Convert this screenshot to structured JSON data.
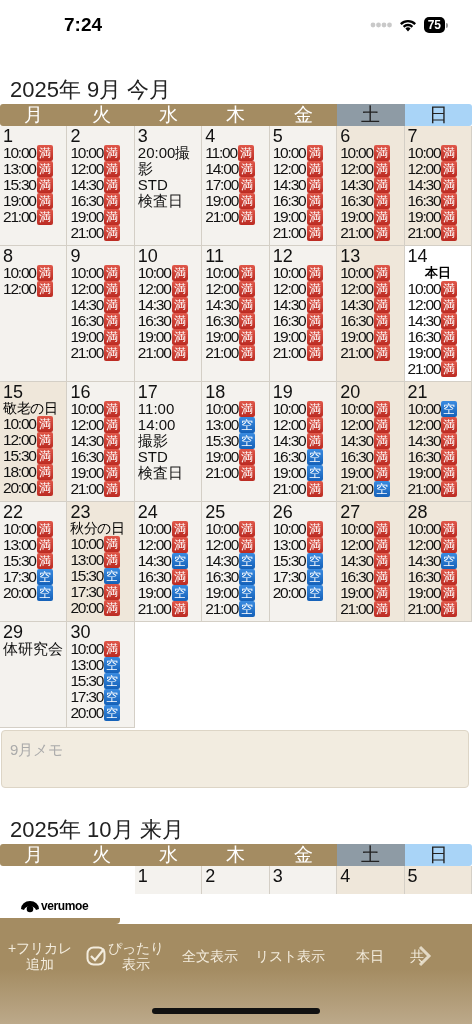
{
  "status_bar": {
    "time": "7:24",
    "battery": "75"
  },
  "months": [
    {
      "title": "2025年 9月 今月",
      "weekdays": [
        {
          "label": "月",
          "kind": "weekday"
        },
        {
          "label": "火",
          "kind": "weekday"
        },
        {
          "label": "水",
          "kind": "weekday"
        },
        {
          "label": "木",
          "kind": "weekday"
        },
        {
          "label": "金",
          "kind": "weekday"
        },
        {
          "label": "土",
          "kind": "saturday"
        },
        {
          "label": "日",
          "kind": "sunday"
        }
      ],
      "weeks": [
        [
          {
            "day": "1",
            "kind": "plain",
            "slots": [
              {
                "time": "10:00",
                "mark": "満",
                "kind": "full"
              },
              {
                "time": "13:00",
                "mark": "満",
                "kind": "full"
              },
              {
                "time": "15:30",
                "mark": "満",
                "kind": "full"
              },
              {
                "time": "19:00",
                "mark": "満",
                "kind": "full"
              },
              {
                "time": "21:00",
                "mark": "満",
                "kind": "full"
              }
            ]
          },
          {
            "day": "2",
            "kind": "plain",
            "slots": [
              {
                "time": "10:00",
                "mark": "満",
                "kind": "full"
              },
              {
                "time": "12:00",
                "mark": "満",
                "kind": "full"
              },
              {
                "time": "14:30",
                "mark": "満",
                "kind": "full"
              },
              {
                "time": "16:30",
                "mark": "満",
                "kind": "full"
              },
              {
                "time": "19:00",
                "mark": "満",
                "kind": "full"
              },
              {
                "time": "21:00",
                "mark": "満",
                "kind": "full"
              }
            ]
          },
          {
            "day": "3",
            "kind": "plain",
            "notes": [
              "20:00撮影",
              "STD",
              "検査日"
            ]
          },
          {
            "day": "4",
            "kind": "plain",
            "slots": [
              {
                "time": "11:00",
                "mark": "満",
                "kind": "full"
              },
              {
                "time": "14:00",
                "mark": "満",
                "kind": "full"
              },
              {
                "time": "17:00",
                "mark": "満",
                "kind": "full"
              },
              {
                "time": "19:00",
                "mark": "満",
                "kind": "full"
              },
              {
                "time": "21:00",
                "mark": "満",
                "kind": "full"
              }
            ]
          },
          {
            "day": "5",
            "kind": "plain",
            "slots": [
              {
                "time": "10:00",
                "mark": "満",
                "kind": "full"
              },
              {
                "time": "12:00",
                "mark": "満",
                "kind": "full"
              },
              {
                "time": "14:30",
                "mark": "満",
                "kind": "full"
              },
              {
                "time": "16:30",
                "mark": "満",
                "kind": "full"
              },
              {
                "time": "19:00",
                "mark": "満",
                "kind": "full"
              },
              {
                "time": "21:00",
                "mark": "満",
                "kind": "full"
              }
            ]
          },
          {
            "day": "6",
            "kind": "shaded",
            "slots": [
              {
                "time": "10:00",
                "mark": "満",
                "kind": "full"
              },
              {
                "time": "12:00",
                "mark": "満",
                "kind": "full"
              },
              {
                "time": "14:30",
                "mark": "満",
                "kind": "full"
              },
              {
                "time": "16:30",
                "mark": "満",
                "kind": "full"
              },
              {
                "time": "19:00",
                "mark": "満",
                "kind": "full"
              },
              {
                "time": "21:00",
                "mark": "満",
                "kind": "full"
              }
            ]
          },
          {
            "day": "7",
            "kind": "shaded",
            "slots": [
              {
                "time": "10:00",
                "mark": "満",
                "kind": "full"
              },
              {
                "time": "12:00",
                "mark": "満",
                "kind": "full"
              },
              {
                "time": "14:30",
                "mark": "満",
                "kind": "full"
              },
              {
                "time": "16:30",
                "mark": "満",
                "kind": "full"
              },
              {
                "time": "19:00",
                "mark": "満",
                "kind": "full"
              },
              {
                "time": "21:00",
                "mark": "満",
                "kind": "full"
              }
            ]
          }
        ],
        [
          {
            "day": "8",
            "kind": "plain",
            "slots": [
              {
                "time": "10:00",
                "mark": "満",
                "kind": "full"
              },
              {
                "time": "12:00",
                "mark": "満",
                "kind": "full"
              }
            ]
          },
          {
            "day": "9",
            "kind": "plain",
            "slots": [
              {
                "time": "10:00",
                "mark": "満",
                "kind": "full"
              },
              {
                "time": "12:00",
                "mark": "満",
                "kind": "full"
              },
              {
                "time": "14:30",
                "mark": "満",
                "kind": "full"
              },
              {
                "time": "16:30",
                "mark": "満",
                "kind": "full"
              },
              {
                "time": "19:00",
                "mark": "満",
                "kind": "full"
              },
              {
                "time": "21:00",
                "mark": "満",
                "kind": "full"
              }
            ]
          },
          {
            "day": "10",
            "kind": "plain",
            "slots": [
              {
                "time": "10:00",
                "mark": "満",
                "kind": "full"
              },
              {
                "time": "12:00",
                "mark": "満",
                "kind": "full"
              },
              {
                "time": "14:30",
                "mark": "満",
                "kind": "full"
              },
              {
                "time": "16:30",
                "mark": "満",
                "kind": "full"
              },
              {
                "time": "19:00",
                "mark": "満",
                "kind": "full"
              },
              {
                "time": "21:00",
                "mark": "満",
                "kind": "full"
              }
            ]
          },
          {
            "day": "11",
            "kind": "plain",
            "slots": [
              {
                "time": "10:00",
                "mark": "満",
                "kind": "full"
              },
              {
                "time": "12:00",
                "mark": "満",
                "kind": "full"
              },
              {
                "time": "14:30",
                "mark": "満",
                "kind": "full"
              },
              {
                "time": "16:30",
                "mark": "満",
                "kind": "full"
              },
              {
                "time": "19:00",
                "mark": "満",
                "kind": "full"
              },
              {
                "time": "21:00",
                "mark": "満",
                "kind": "full"
              }
            ]
          },
          {
            "day": "12",
            "kind": "plain",
            "slots": [
              {
                "time": "10:00",
                "mark": "満",
                "kind": "full"
              },
              {
                "time": "12:00",
                "mark": "満",
                "kind": "full"
              },
              {
                "time": "14:30",
                "mark": "満",
                "kind": "full"
              },
              {
                "time": "16:30",
                "mark": "満",
                "kind": "full"
              },
              {
                "time": "19:00",
                "mark": "満",
                "kind": "full"
              },
              {
                "time": "21:00",
                "mark": "満",
                "kind": "full"
              }
            ]
          },
          {
            "day": "13",
            "kind": "shaded",
            "slots": [
              {
                "time": "10:00",
                "mark": "満",
                "kind": "full"
              },
              {
                "time": "12:00",
                "mark": "満",
                "kind": "full"
              },
              {
                "time": "14:30",
                "mark": "満",
                "kind": "full"
              },
              {
                "time": "16:30",
                "mark": "満",
                "kind": "full"
              },
              {
                "time": "19:00",
                "mark": "満",
                "kind": "full"
              },
              {
                "time": "21:00",
                "mark": "満",
                "kind": "full"
              }
            ]
          },
          {
            "day": "14",
            "kind": "today",
            "label": "本日",
            "slots": [
              {
                "time": "10:00",
                "mark": "満",
                "kind": "full"
              },
              {
                "time": "12:00",
                "mark": "満",
                "kind": "full"
              },
              {
                "time": "14:30",
                "mark": "満",
                "kind": "full"
              },
              {
                "time": "16:30",
                "mark": "満",
                "kind": "full"
              },
              {
                "time": "19:00",
                "mark": "満",
                "kind": "full"
              },
              {
                "time": "21:00",
                "mark": "満",
                "kind": "full"
              }
            ]
          }
        ],
        [
          {
            "day": "15",
            "kind": "shaded",
            "label": "敬老の日",
            "slots": [
              {
                "time": "10:00",
                "mark": "満",
                "kind": "full"
              },
              {
                "time": "12:00",
                "mark": "満",
                "kind": "full"
              },
              {
                "time": "15:30",
                "mark": "満",
                "kind": "full"
              },
              {
                "time": "18:00",
                "mark": "満",
                "kind": "full"
              },
              {
                "time": "20:00",
                "mark": "満",
                "kind": "full"
              }
            ]
          },
          {
            "day": "16",
            "kind": "plain",
            "slots": [
              {
                "time": "10:00",
                "mark": "満",
                "kind": "full"
              },
              {
                "time": "12:00",
                "mark": "満",
                "kind": "full"
              },
              {
                "time": "14:30",
                "mark": "満",
                "kind": "full"
              },
              {
                "time": "16:30",
                "mark": "満",
                "kind": "full"
              },
              {
                "time": "19:00",
                "mark": "満",
                "kind": "full"
              },
              {
                "time": "21:00",
                "mark": "満",
                "kind": "full"
              }
            ]
          },
          {
            "day": "17",
            "kind": "plain",
            "notes": [
              "11:00",
              "14:00",
              "撮影",
              "STD",
              "検査日"
            ]
          },
          {
            "day": "18",
            "kind": "plain",
            "slots": [
              {
                "time": "10:00",
                "mark": "満",
                "kind": "full"
              },
              {
                "time": "13:00",
                "mark": "空",
                "kind": "open"
              },
              {
                "time": "15:30",
                "mark": "空",
                "kind": "open"
              },
              {
                "time": "19:00",
                "mark": "満",
                "kind": "full"
              },
              {
                "time": "21:00",
                "mark": "満",
                "kind": "full"
              }
            ]
          },
          {
            "day": "19",
            "kind": "plain",
            "slots": [
              {
                "time": "10:00",
                "mark": "満",
                "kind": "full"
              },
              {
                "time": "12:00",
                "mark": "満",
                "kind": "full"
              },
              {
                "time": "14:30",
                "mark": "満",
                "kind": "full"
              },
              {
                "time": "16:30",
                "mark": "空",
                "kind": "open"
              },
              {
                "time": "19:00",
                "mark": "空",
                "kind": "open"
              },
              {
                "time": "21:00",
                "mark": "満",
                "kind": "full"
              }
            ]
          },
          {
            "day": "20",
            "kind": "shaded",
            "slots": [
              {
                "time": "10:00",
                "mark": "満",
                "kind": "full"
              },
              {
                "time": "12:00",
                "mark": "満",
                "kind": "full"
              },
              {
                "time": "14:30",
                "mark": "満",
                "kind": "full"
              },
              {
                "time": "16:30",
                "mark": "満",
                "kind": "full"
              },
              {
                "time": "19:00",
                "mark": "満",
                "kind": "full"
              },
              {
                "time": "21:00",
                "mark": "空",
                "kind": "open"
              }
            ]
          },
          {
            "day": "21",
            "kind": "shaded",
            "slots": [
              {
                "time": "10:00",
                "mark": "空",
                "kind": "open"
              },
              {
                "time": "12:00",
                "mark": "満",
                "kind": "full"
              },
              {
                "time": "14:30",
                "mark": "満",
                "kind": "full"
              },
              {
                "time": "16:30",
                "mark": "満",
                "kind": "full"
              },
              {
                "time": "19:00",
                "mark": "満",
                "kind": "full"
              },
              {
                "time": "21:00",
                "mark": "満",
                "kind": "full"
              }
            ]
          }
        ],
        [
          {
            "day": "22",
            "kind": "plain",
            "slots": [
              {
                "time": "10:00",
                "mark": "満",
                "kind": "full"
              },
              {
                "time": "13:00",
                "mark": "満",
                "kind": "full"
              },
              {
                "time": "15:30",
                "mark": "満",
                "kind": "full"
              },
              {
                "time": "17:30",
                "mark": "空",
                "kind": "open"
              },
              {
                "time": "20:00",
                "mark": "空",
                "kind": "open"
              }
            ]
          },
          {
            "day": "23",
            "kind": "shaded",
            "label": "秋分の日",
            "slots": [
              {
                "time": "10:00",
                "mark": "満",
                "kind": "full"
              },
              {
                "time": "13:00",
                "mark": "満",
                "kind": "full"
              },
              {
                "time": "15:30",
                "mark": "空",
                "kind": "open"
              },
              {
                "time": "17:30",
                "mark": "満",
                "kind": "full"
              },
              {
                "time": "20:00",
                "mark": "満",
                "kind": "full"
              }
            ]
          },
          {
            "day": "24",
            "kind": "plain",
            "slots": [
              {
                "time": "10:00",
                "mark": "満",
                "kind": "full"
              },
              {
                "time": "12:00",
                "mark": "満",
                "kind": "full"
              },
              {
                "time": "14:30",
                "mark": "空",
                "kind": "open"
              },
              {
                "time": "16:30",
                "mark": "満",
                "kind": "full"
              },
              {
                "time": "19:00",
                "mark": "空",
                "kind": "open"
              },
              {
                "time": "21:00",
                "mark": "満",
                "kind": "full"
              }
            ]
          },
          {
            "day": "25",
            "kind": "plain",
            "slots": [
              {
                "time": "10:00",
                "mark": "満",
                "kind": "full"
              },
              {
                "time": "12:00",
                "mark": "満",
                "kind": "full"
              },
              {
                "time": "14:30",
                "mark": "空",
                "kind": "open"
              },
              {
                "time": "16:30",
                "mark": "空",
                "kind": "open"
              },
              {
                "time": "19:00",
                "mark": "空",
                "kind": "open"
              },
              {
                "time": "21:00",
                "mark": "空",
                "kind": "open"
              }
            ]
          },
          {
            "day": "26",
            "kind": "plain",
            "slots": [
              {
                "time": "10:00",
                "mark": "満",
                "kind": "full"
              },
              {
                "time": "13:00",
                "mark": "満",
                "kind": "full"
              },
              {
                "time": "15:30",
                "mark": "空",
                "kind": "open"
              },
              {
                "time": "17:30",
                "mark": "空",
                "kind": "open"
              },
              {
                "time": "20:00",
                "mark": "空",
                "kind": "open"
              }
            ]
          },
          {
            "day": "27",
            "kind": "shaded",
            "slots": [
              {
                "time": "10:00",
                "mark": "満",
                "kind": "full"
              },
              {
                "time": "12:00",
                "mark": "満",
                "kind": "full"
              },
              {
                "time": "14:30",
                "mark": "満",
                "kind": "full"
              },
              {
                "time": "16:30",
                "mark": "満",
                "kind": "full"
              },
              {
                "time": "19:00",
                "mark": "満",
                "kind": "full"
              },
              {
                "time": "21:00",
                "mark": "満",
                "kind": "full"
              }
            ]
          },
          {
            "day": "28",
            "kind": "shaded",
            "slots": [
              {
                "time": "10:00",
                "mark": "満",
                "kind": "full"
              },
              {
                "time": "12:00",
                "mark": "満",
                "kind": "full"
              },
              {
                "time": "14:30",
                "mark": "空",
                "kind": "open"
              },
              {
                "time": "16:30",
                "mark": "満",
                "kind": "full"
              },
              {
                "time": "19:00",
                "mark": "満",
                "kind": "full"
              },
              {
                "time": "21:00",
                "mark": "満",
                "kind": "full"
              }
            ]
          }
        ],
        [
          {
            "day": "29",
            "kind": "plain",
            "notes": [
              "体研究会"
            ]
          },
          {
            "day": "30",
            "kind": "plain",
            "slots": [
              {
                "time": "10:00",
                "mark": "満",
                "kind": "full"
              },
              {
                "time": "13:00",
                "mark": "空",
                "kind": "open"
              },
              {
                "time": "15:30",
                "mark": "空",
                "kind": "open"
              },
              {
                "time": "17:30",
                "mark": "空",
                "kind": "open"
              },
              {
                "time": "20:00",
                "mark": "空",
                "kind": "open"
              }
            ]
          },
          {
            "kind": "empty"
          },
          {
            "kind": "empty"
          },
          {
            "kind": "empty"
          },
          {
            "kind": "empty"
          },
          {
            "kind": "empty"
          }
        ]
      ],
      "memo": {
        "placeholder": "9月メモ"
      }
    },
    {
      "title": "2025年 10月 来月",
      "weekdays": [
        {
          "label": "月",
          "kind": "weekday"
        },
        {
          "label": "火",
          "kind": "weekday"
        },
        {
          "label": "水",
          "kind": "weekday"
        },
        {
          "label": "木",
          "kind": "weekday"
        },
        {
          "label": "金",
          "kind": "weekday"
        },
        {
          "label": "土",
          "kind": "saturday"
        },
        {
          "label": "日",
          "kind": "sunday"
        }
      ],
      "weeks": [
        [
          {
            "kind": "empty"
          },
          {
            "kind": "empty"
          },
          {
            "day": "1",
            "kind": "plain"
          },
          {
            "day": "2",
            "kind": "plain"
          },
          {
            "day": "3",
            "kind": "plain"
          },
          {
            "day": "4",
            "kind": "shaded"
          },
          {
            "day": "5",
            "kind": "shaded"
          }
        ]
      ]
    }
  ],
  "logo": {
    "text": "verumoe"
  },
  "toolbar": [
    {
      "kind": "text",
      "lines": [
        "+フリカレ",
        "追加"
      ]
    },
    {
      "kind": "check",
      "checked": true,
      "lines": [
        "ぴったり",
        "表示"
      ]
    },
    {
      "kind": "text",
      "lines": [
        "全文表示"
      ]
    },
    {
      "kind": "text",
      "lines": [
        "リスト表示"
      ]
    },
    {
      "kind": "text",
      "lines": [
        "本日"
      ]
    },
    {
      "kind": "more",
      "lines": [
        "共"
      ]
    }
  ]
}
